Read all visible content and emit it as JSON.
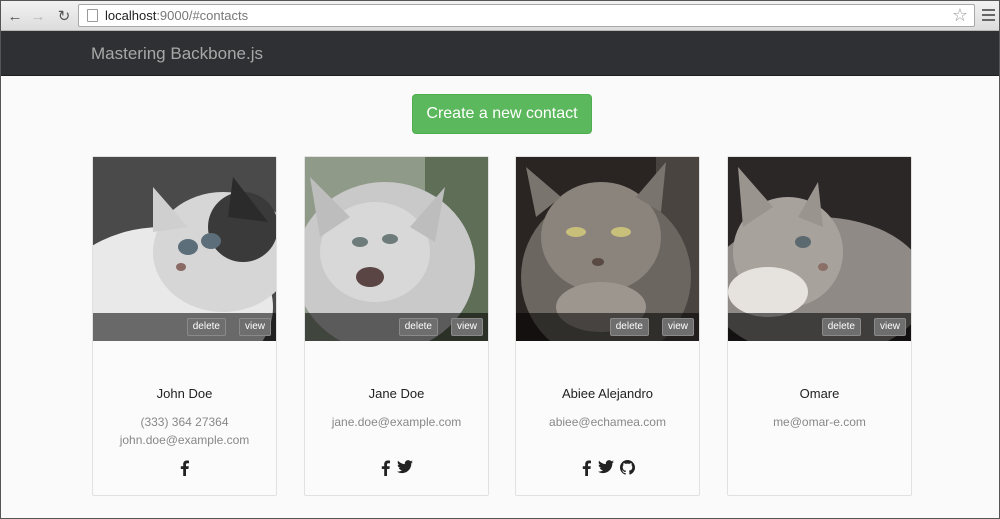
{
  "browser": {
    "url_host": "localhost",
    "url_rest": ":9000/#contacts"
  },
  "navbar": {
    "brand": "Mastering Backbone.js"
  },
  "main": {
    "create_label": "Create a new contact"
  },
  "cards": [
    {
      "name": "John Doe",
      "lines": [
        "(333) 364 27364",
        "john.doe@example.com"
      ],
      "social": [
        "facebook-icon"
      ],
      "delete_label": "delete",
      "view_label": "view"
    },
    {
      "name": "Jane Doe",
      "lines": [
        "jane.doe@example.com"
      ],
      "social": [
        "facebook-icon",
        "twitter-icon"
      ],
      "delete_label": "delete",
      "view_label": "view"
    },
    {
      "name": "Abiee Alejandro",
      "lines": [
        "abiee@echamea.com"
      ],
      "social": [
        "facebook-icon",
        "twitter-icon",
        "github-icon"
      ],
      "delete_label": "delete",
      "view_label": "view"
    },
    {
      "name": "Omare",
      "lines": [
        "me@omar-e.com"
      ],
      "social": [],
      "delete_label": "delete",
      "view_label": "view"
    }
  ],
  "colors": {
    "navbar": "#2f3033",
    "create_button": "#5cb85c",
    "page_background": "#fafafa"
  }
}
